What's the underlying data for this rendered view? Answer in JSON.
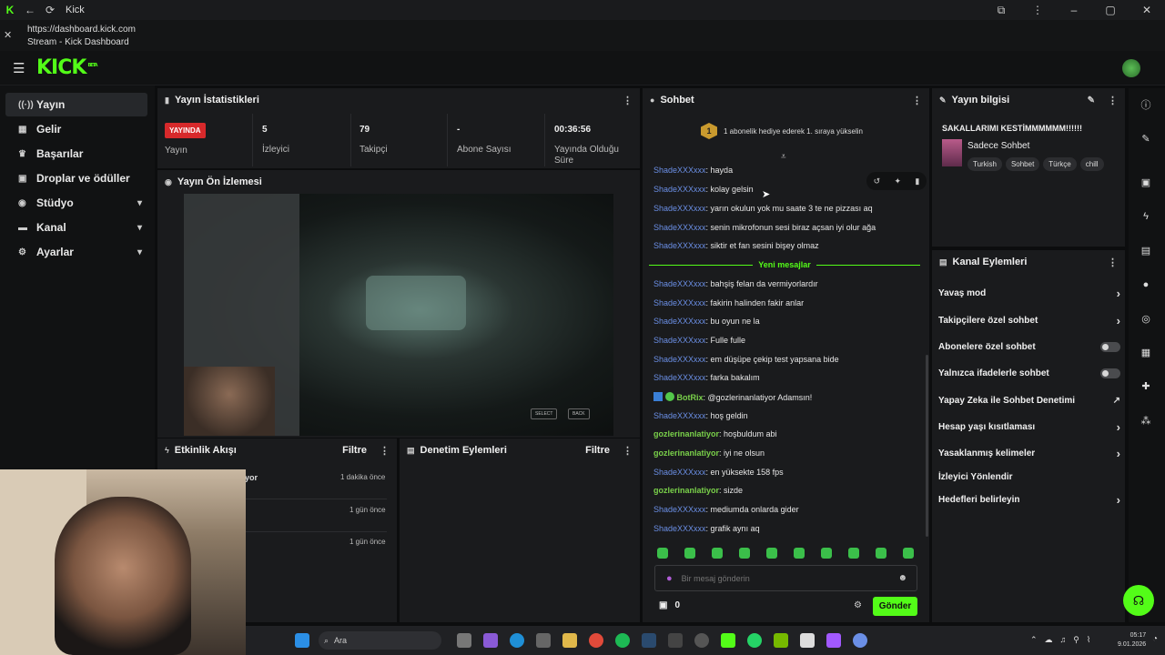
{
  "window": {
    "title": "Kick"
  },
  "address": {
    "url": "https://dashboard.kick.com",
    "subtitle": "Stream - Kick Dashboard"
  },
  "nav": {
    "logo": "KICK",
    "logo_sup": "BETA"
  },
  "sidebar": {
    "items": [
      {
        "label": "Yayın",
        "icon": "broadcast-icon"
      },
      {
        "label": "Gelir",
        "icon": "money-icon"
      },
      {
        "label": "Başarılar",
        "icon": "trophy-icon"
      },
      {
        "label": "Droplar ve ödüller",
        "icon": "gift-icon"
      },
      {
        "label": "Stüdyo",
        "icon": "studio-icon"
      },
      {
        "label": "Kanal",
        "icon": "channel-icon"
      },
      {
        "label": "Ayarlar",
        "icon": "settings-icon"
      }
    ]
  },
  "stats": {
    "title": "Yayın İstatistikleri",
    "live_badge": "YAYINDA",
    "live_label": "Yayın",
    "viewers_value": "5",
    "viewers_label": "İzleyici",
    "followers_value": "79",
    "followers_label": "Takipçi",
    "subs_value": "-",
    "subs_label": "Abone Sayısı",
    "uptime_value": "00:36:56",
    "uptime_label": "Yayında Olduğu Süre"
  },
  "preview": {
    "title": "Yayın Ön İzlemesi",
    "btn_select": "SELECT",
    "btn_back": "BACK"
  },
  "activity": {
    "title": "Etkinlik Akışı",
    "filter": "Filtre",
    "row1_suffix": "yor",
    "times": [
      "1 dakika önce",
      "1 gün önce",
      "1 gün önce"
    ]
  },
  "moderation": {
    "title": "Denetim Eylemleri",
    "filter": "Filtre"
  },
  "chat": {
    "title": "Sohbet",
    "gift_badge": "1",
    "gift_text": "1 abonelik hediye ederek 1. sıraya yükselin",
    "new_messages": "Yeni mesajlar",
    "messages_before": [
      {
        "user": "ShadeXXXxxx",
        "text": ": hayda"
      },
      {
        "user": "ShadeXXXxxx",
        "text": ": kolay gelsin"
      },
      {
        "user": "ShadeXXXxxx",
        "text": ": yarın okulun yok mu saate 3 te ne pizzası aq"
      },
      {
        "user": "ShadeXXXxxx",
        "text": ": senin mikrofonun sesi biraz açsan iyi olur ağa"
      },
      {
        "user": "ShadeXXXxxx",
        "text": ": siktir et fan sesini bişey olmaz"
      }
    ],
    "messages_after": [
      {
        "user": "ShadeXXXxxx",
        "text": ": bahşiş felan da vermiyorlardır",
        "kind": "blue"
      },
      {
        "user": "ShadeXXXxxx",
        "text": ": fakirin halinden fakir anlar",
        "kind": "blue"
      },
      {
        "user": "ShadeXXXxxx",
        "text": ": bu oyun ne la",
        "kind": "blue"
      },
      {
        "user": "ShadeXXXxxx",
        "text": ": Fulle fulle",
        "kind": "blue"
      },
      {
        "user": "ShadeXXXxxx",
        "text": ": em düşüpe çekip test yapsana bide",
        "kind": "blue"
      },
      {
        "user": "ShadeXXXxxx",
        "text": ": farka bakalım",
        "kind": "blue"
      },
      {
        "user": "BotRix",
        "text": ": @gozlerinanlatiyor Adamsın!",
        "kind": "bot"
      },
      {
        "user": "ShadeXXXxxx",
        "text": ": hoş geldin",
        "kind": "blue"
      },
      {
        "user": "gozlerinanlatiyor",
        "text": ": hoşbuldum abi",
        "kind": "green"
      },
      {
        "user": "gozlerinanlatiyor",
        "text": ": iyi ne olsun",
        "kind": "green"
      },
      {
        "user": "ShadeXXXxxx",
        "text": ": en yüksekte 158 fps",
        "kind": "blue"
      },
      {
        "user": "gozlerinanlatiyor",
        "text": ": sizde",
        "kind": "green"
      },
      {
        "user": "ShadeXXXxxx",
        "text": ": mediumda onlarda gider",
        "kind": "blue"
      },
      {
        "user": "ShadeXXXxxx",
        "text": ": grafik aynı aq",
        "kind": "blue"
      }
    ],
    "input_placeholder": "Bir mesaj gönderin",
    "points": "0",
    "send": "Gönder"
  },
  "stream_info": {
    "title": "Yayın bilgisi",
    "stream_title": "SAKALLARIMI KESTİMMMMMM!!!!!!",
    "category": "Sadece Sohbet",
    "tags": [
      "Turkish",
      "Sohbet",
      "Türkçe",
      "chill"
    ]
  },
  "channel_actions": {
    "title": "Kanal Eylemleri",
    "items": [
      {
        "label": "Yavaş mod",
        "control": "chevron"
      },
      {
        "label": "Takipçilere özel sohbet",
        "control": "chevron"
      },
      {
        "label": "Abonelere özel sohbet",
        "control": "toggle"
      },
      {
        "label": "Yalnızca ifadelerle sohbet",
        "control": "toggle"
      },
      {
        "label": "Yapay Zeka ile Sohbet Denetimi",
        "control": "external"
      },
      {
        "label": "Hesap yaşı kısıtlaması",
        "control": "chevron"
      },
      {
        "label": "Yasaklanmış kelimeler",
        "control": "chevron"
      },
      {
        "label": "İzleyici Yönlendir",
        "control": "none"
      },
      {
        "label": "Hedefleri belirleyin",
        "control": "chevron"
      }
    ]
  },
  "taskbar": {
    "search": "Ara",
    "time": "05:17",
    "date": "9.01.2026"
  },
  "colors": {
    "accent": "#53fc18",
    "live": "#d7292b",
    "user_blue": "#6b8fe6",
    "user_green": "#7ad14a"
  }
}
